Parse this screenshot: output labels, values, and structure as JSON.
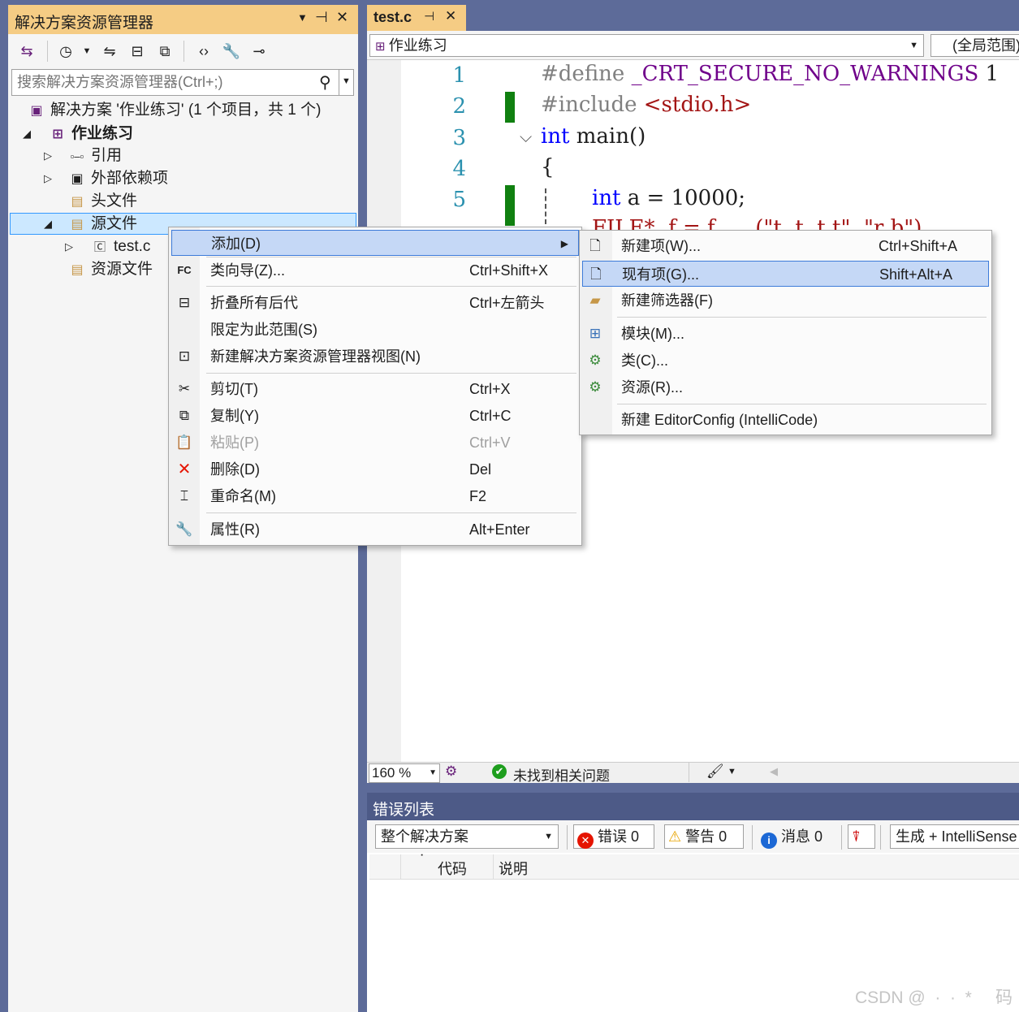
{
  "solution_explorer": {
    "title": "解决方案资源管理器",
    "pin_glyph": "▼  ⊣  ✕",
    "search_placeholder": "搜索解决方案资源管理器(Ctrl+;)",
    "tree": {
      "solution": "解决方案 '作业练习' (1 个项目，共 1 个)",
      "project": "作业练习",
      "references": "引用",
      "external_deps": "外部依赖项",
      "header_files": "头文件",
      "source_files": "源文件",
      "test_c": "test.c",
      "resource_files": "资源文件"
    }
  },
  "editor": {
    "tab_label": "test.c",
    "project_combo": "作业练习",
    "scope_combo": "(全局范围)",
    "line_numbers": [
      "1",
      "2",
      "3",
      "4",
      "5"
    ],
    "code": {
      "l1_pp": "#define ",
      "l1_macro": "_CRT_SECURE_NO_WARNINGS",
      "l1_val": " 1",
      "l2_pp": "#include ",
      "l2_str": "<stdio.h>",
      "l3_kw": "int",
      "l3_rest": " main()",
      "l4": "{",
      "l5_kw": "int",
      "l5_rest": " a = 10000;",
      "l6_partial": "FILE*  f = f      (\"t  t  t t\", \"r b\")"
    },
    "zoom": "160 %",
    "status": "未找到相关问题"
  },
  "context_menu": {
    "items": [
      {
        "label": "添加(D)",
        "shortcut": ""
      },
      {
        "label": "类向导(Z)...",
        "shortcut": "Ctrl+Shift+X"
      },
      {
        "label": "折叠所有后代",
        "shortcut": "Ctrl+左箭头"
      },
      {
        "label": "限定为此范围(S)",
        "shortcut": ""
      },
      {
        "label": "新建解决方案资源管理器视图(N)",
        "shortcut": ""
      },
      {
        "label": "剪切(T)",
        "shortcut": "Ctrl+X"
      },
      {
        "label": "复制(Y)",
        "shortcut": "Ctrl+C"
      },
      {
        "label": "粘贴(P)",
        "shortcut": "Ctrl+V"
      },
      {
        "label": "删除(D)",
        "shortcut": "Del"
      },
      {
        "label": "重命名(M)",
        "shortcut": "F2"
      },
      {
        "label": "属性(R)",
        "shortcut": "Alt+Enter"
      }
    ]
  },
  "submenu": {
    "items": [
      {
        "label": "新建项(W)...",
        "shortcut": "Ctrl+Shift+A"
      },
      {
        "label": "现有项(G)...",
        "shortcut": "Shift+Alt+A"
      },
      {
        "label": "新建筛选器(F)",
        "shortcut": ""
      },
      {
        "label": "模块(M)...",
        "shortcut": ""
      },
      {
        "label": "类(C)...",
        "shortcut": ""
      },
      {
        "label": "资源(R)...",
        "shortcut": ""
      },
      {
        "label": "新建 EditorConfig (IntelliCode)",
        "shortcut": ""
      }
    ]
  },
  "error_list": {
    "title": "错误列表",
    "scope": "整个解决方案",
    "errors": "错误 0",
    "warnings": "警告 0",
    "messages": "消息 0",
    "build": "生成 + IntelliSense",
    "col_code": "代码",
    "col_desc": "说明"
  },
  "watermark": "CSDN @  ·  ·  *     码"
}
